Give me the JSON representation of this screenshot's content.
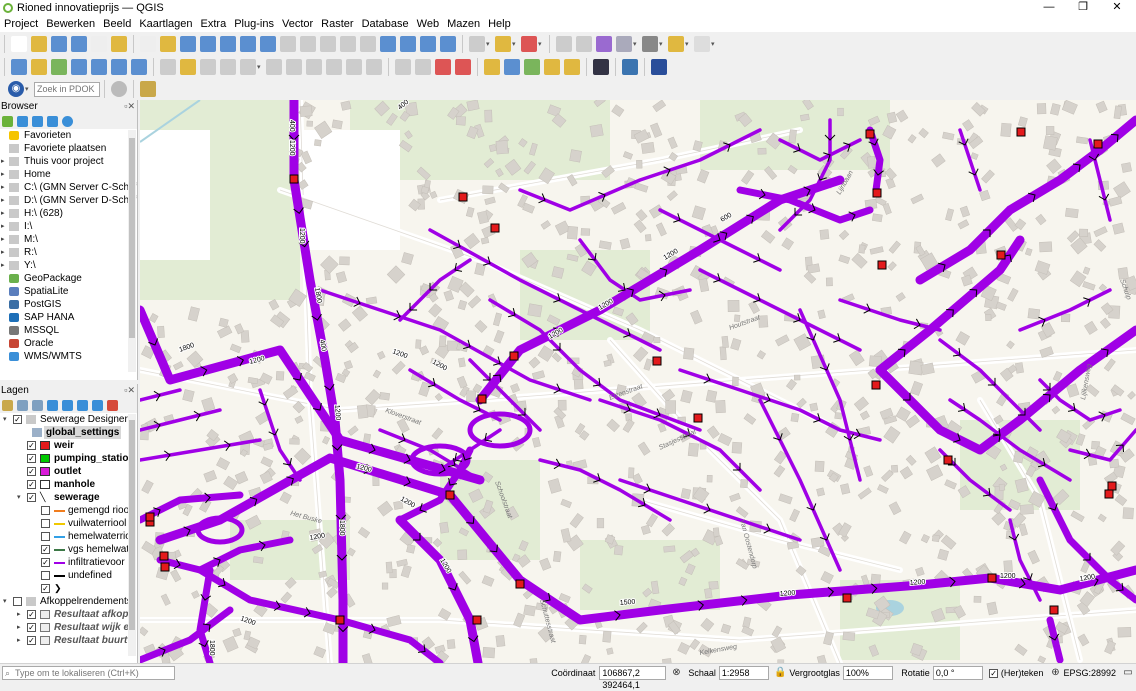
{
  "window": {
    "title": "Rioned innovatieprijs — QGIS",
    "minimize": "—",
    "maximize": "❐",
    "close": "✕"
  },
  "menu": [
    "Project",
    "Bewerken",
    "Beeld",
    "Kaartlagen",
    "Extra",
    "Plug-ins",
    "Vector",
    "Raster",
    "Database",
    "Web",
    "Mazen",
    "Help"
  ],
  "locator_toolbar": {
    "search_placeholder": "Zoek in PDOK L..."
  },
  "browser": {
    "title": "Browser",
    "items": [
      {
        "label": "Favorieten",
        "icon": "star-icon",
        "arrow": ""
      },
      {
        "label": "Favoriete plaatsen",
        "icon": "folder-icon",
        "arrow": ""
      },
      {
        "label": "Thuis voor project",
        "icon": "folder-icon",
        "arrow": "▸"
      },
      {
        "label": "Home",
        "icon": "folder-icon",
        "arrow": "▸"
      },
      {
        "label": "C:\\ (GMN Server C-Schijf E",
        "icon": "folder-icon",
        "arrow": "▸"
      },
      {
        "label": "D:\\ (GMN Server D-Schijf",
        "icon": "folder-icon",
        "arrow": "▸"
      },
      {
        "label": "H:\\ (628)",
        "icon": "folder-icon",
        "arrow": "▸"
      },
      {
        "label": "I:\\",
        "icon": "folder-icon",
        "arrow": "▸"
      },
      {
        "label": "M:\\",
        "icon": "folder-icon",
        "arrow": "▸"
      },
      {
        "label": "R:\\",
        "icon": "folder-icon",
        "arrow": "▸"
      },
      {
        "label": "Y:\\",
        "icon": "folder-icon",
        "arrow": "▸"
      },
      {
        "label": "GeoPackage",
        "icon": "geopackage-icon",
        "arrow": ""
      },
      {
        "label": "SpatiaLite",
        "icon": "spatialite-icon",
        "arrow": ""
      },
      {
        "label": "PostGIS",
        "icon": "postgis-icon",
        "arrow": ""
      },
      {
        "label": "SAP HANA",
        "icon": "sap-hana-icon",
        "arrow": ""
      },
      {
        "label": "MSSQL",
        "icon": "mssql-icon",
        "arrow": ""
      },
      {
        "label": "Oracle",
        "icon": "oracle-icon",
        "arrow": ""
      },
      {
        "label": "WMS/WMTS",
        "icon": "wms-icon",
        "arrow": ""
      }
    ]
  },
  "layers": {
    "title": "Lagen",
    "items": [
      {
        "label": "Sewerage Designer",
        "type": "group",
        "checked": true,
        "bold": false,
        "italic": false,
        "indent": 0,
        "swatch": ""
      },
      {
        "label": "global_settings",
        "type": "table",
        "checked": null,
        "bold": true,
        "italic": false,
        "indent": 1,
        "swatch": ""
      },
      {
        "label": "weir",
        "type": "point",
        "checked": true,
        "bold": true,
        "italic": false,
        "indent": 1,
        "swatch": "#e31a1c"
      },
      {
        "label": "pumping_station",
        "type": "point",
        "checked": true,
        "bold": true,
        "italic": false,
        "indent": 1,
        "swatch": "#00c800"
      },
      {
        "label": "outlet",
        "type": "point",
        "checked": true,
        "bold": true,
        "italic": false,
        "indent": 1,
        "swatch": "#d81ad8"
      },
      {
        "label": "manhole",
        "type": "point",
        "checked": true,
        "bold": true,
        "italic": false,
        "indent": 1,
        "swatch": "#ffffff"
      },
      {
        "label": "sewerage",
        "type": "line-group",
        "checked": true,
        "bold": true,
        "italic": false,
        "indent": 1,
        "swatch": ""
      },
      {
        "label": "gemengd riool",
        "type": "line",
        "checked": false,
        "bold": false,
        "italic": false,
        "indent": 2,
        "swatch": "#f07d1e"
      },
      {
        "label": "vuilwaterriool",
        "type": "line",
        "checked": false,
        "bold": false,
        "italic": false,
        "indent": 2,
        "swatch": "#f0c800"
      },
      {
        "label": "hemelwaterriool",
        "type": "line",
        "checked": false,
        "bold": false,
        "italic": false,
        "indent": 2,
        "swatch": "#32a0e6"
      },
      {
        "label": "vgs hemelwat",
        "type": "line",
        "checked": true,
        "bold": false,
        "italic": false,
        "indent": 2,
        "swatch": "#3c7846"
      },
      {
        "label": "infiltratievoor",
        "type": "line",
        "checked": true,
        "bold": false,
        "italic": false,
        "indent": 2,
        "swatch": "#a000e6"
      },
      {
        "label": "undefined",
        "type": "line",
        "checked": false,
        "bold": false,
        "italic": false,
        "indent": 2,
        "swatch": "#000000"
      },
      {
        "label": "",
        "type": "arrow",
        "checked": true,
        "bold": false,
        "italic": false,
        "indent": 2,
        "swatch": ""
      },
      {
        "label": "Afkoppelrendements",
        "type": "group",
        "checked": false,
        "bold": false,
        "italic": false,
        "indent": 0,
        "swatch": ""
      },
      {
        "label": "Resultaat afkop",
        "type": "polygon",
        "checked": true,
        "bold": true,
        "italic": true,
        "indent": 1,
        "swatch": ""
      },
      {
        "label": "Resultaat wijk e",
        "type": "polygon",
        "checked": true,
        "bold": true,
        "italic": true,
        "indent": 1,
        "swatch": ""
      },
      {
        "label": "Resultaat buurt",
        "type": "polygon",
        "checked": true,
        "bold": true,
        "italic": true,
        "indent": 1,
        "swatch": ""
      }
    ]
  },
  "map": {
    "pipe_color": "#a000e6",
    "pipe_labels": [
      "400",
      "400",
      "400",
      "1200",
      "1200",
      "1800",
      "1200",
      "1800",
      "400",
      "1200",
      "1200",
      "1200",
      "1200",
      "1200",
      "600",
      "1800",
      "1200",
      "1200",
      "1200",
      "1200",
      "1200",
      "1500",
      "1200",
      "1200",
      "1200",
      "1200",
      "1200",
      "1800"
    ],
    "street_labels": [
      "Kloverstraat",
      "Het Buske",
      "Schoolstraat",
      "Schuttesstraat",
      "Stasjesstraat",
      "Van Oostendorp",
      "Elzenstraat",
      "Houtstraat",
      "Kelkensweg",
      "Lijlkensweg",
      "Lijnbaan",
      "Schulp"
    ]
  },
  "statusbar": {
    "locate_placeholder": "Type om te lokaliseren (Ctrl+K)",
    "coord_label": "Coördinaat",
    "coord_value": "106867,2 392464,1",
    "scale_label": "Schaal",
    "scale_value": "1:2958",
    "magnifier_label": "Vergrootglas",
    "magnifier_value": "100%",
    "rotation_label": "Rotatie",
    "rotation_value": "0,0 °",
    "render_label": "(Her)teken",
    "crs": "EPSG:28992"
  }
}
